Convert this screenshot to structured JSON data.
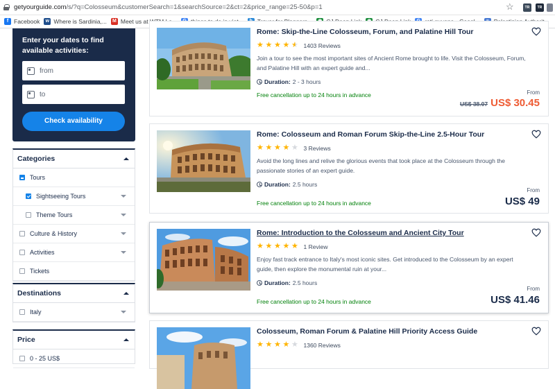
{
  "browser": {
    "url_host": "getyourguide.com",
    "url_rest": "/s/?q=Colosseum&customerSearch=1&searchSource=2&ct=2&price_range=25-50&p=1",
    "bookmarks": [
      {
        "label": "Facebook",
        "icon": "facebook-icon",
        "color": "#1877f2",
        "glyph": "f"
      },
      {
        "label": "Where is Sardinia,...",
        "icon": "guide-icon",
        "color": "#1f4e8c",
        "glyph": "w"
      },
      {
        "label": "Meet us at WTM Lo...",
        "icon": "gmail-icon",
        "color": "#d93025",
        "glyph": "M"
      },
      {
        "label": "things to do in viet...",
        "icon": "google-icon",
        "color": "#4285f4",
        "glyph": "G"
      },
      {
        "label": "Trover for Bloggers...",
        "icon": "trover-icon",
        "color": "#2e8bd8",
        "glyph": "h"
      },
      {
        "label": "CJ Deep Link",
        "icon": "cj-icon",
        "color": "#1e8e3e",
        "glyph": "◉"
      },
      {
        "label": "CJ Deep Link",
        "icon": "cj-icon",
        "color": "#1e8e3e",
        "glyph": "◉"
      },
      {
        "label": "roti guyana - Googl...",
        "icon": "google-icon",
        "color": "#4285f4",
        "glyph": "G"
      },
      {
        "label": "Palestinian Authorit...",
        "icon": "docs-icon",
        "color": "#4a7bd3",
        "glyph": "≡"
      }
    ]
  },
  "dates": {
    "title": "Enter your dates to find available activities:",
    "from_label": "from",
    "to_label": "to",
    "button": "Check availability"
  },
  "categories": {
    "title": "Categories",
    "items": [
      {
        "label": "Tours",
        "state": "partial",
        "sub": false
      },
      {
        "label": "Sightseeing Tours",
        "state": "checked",
        "sub": true
      },
      {
        "label": "Theme Tours",
        "state": "unchecked",
        "sub": true
      },
      {
        "label": "Culture & History",
        "state": "unchecked",
        "sub": false
      },
      {
        "label": "Activities",
        "state": "unchecked",
        "sub": false
      },
      {
        "label": "Tickets",
        "state": "unchecked",
        "sub": false
      }
    ]
  },
  "destinations": {
    "title": "Destinations",
    "items": [
      {
        "label": "Italy"
      }
    ]
  },
  "price_filter": {
    "title": "Price",
    "items": [
      {
        "label": "0 - 25 US$"
      }
    ]
  },
  "results": [
    {
      "title": "Rome: Skip-the-Line Colosseum, Forum, and Palatine Hill Tour",
      "rating": 4.5,
      "reviews": "1403 Reviews",
      "desc": "Join a tour to see the most important sites of Ancient Rome brought to life. Visit the Colosseum, Forum, and Palatine Hill with an expert guide and...",
      "duration_label": "Duration:",
      "duration": "2 - 3 hours",
      "cancel": "Free cancellation up to 24 hours in advance",
      "from": "From",
      "old_price": "US$ 38.07",
      "price": "US$ 30.45",
      "linked": false
    },
    {
      "title": "Rome: Colosseum and Roman Forum Skip-the-Line 2.5-Hour Tour",
      "rating": 4,
      "reviews": "3 Reviews",
      "desc": "Avoid the long lines and relive the glorious events that took place at the Colosseum through the passionate stories of an expert guide.",
      "duration_label": "Duration:",
      "duration": "2.5 hours",
      "cancel": "Free cancellation up to 24 hours in advance",
      "from": "From",
      "old_price": "",
      "price": "US$ 49",
      "linked": false
    },
    {
      "title": "Rome: Introduction to the Colosseum and Ancient City Tour",
      "rating": 5,
      "reviews": "1 Review",
      "desc": "Enjoy fast track entrance to Italy's most iconic sites. Get introduced to the Colosseum by an expert guide, then explore the monumental ruin at your...",
      "duration_label": "Duration:",
      "duration": "2.5 hours",
      "cancel": "Free cancellation up to 24 hours in advance",
      "from": "From",
      "old_price": "",
      "price": "US$ 41.46",
      "linked": true
    },
    {
      "title": "Colosseum, Roman Forum & Palatine Hill Priority Access Guide",
      "rating": 4,
      "reviews": "1360 Reviews",
      "linked": false
    }
  ],
  "colors": {
    "navy": "#1a2b49",
    "accent": "#1583e8",
    "sale": "#ee5b33",
    "green": "#008009",
    "star": "#ffb400"
  }
}
